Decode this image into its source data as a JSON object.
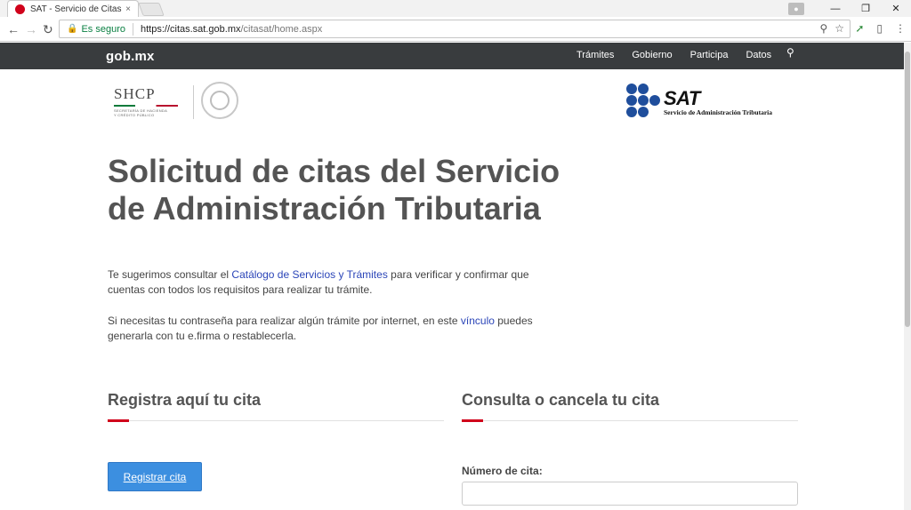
{
  "browser": {
    "tab_title": "SAT - Servicio de Citas",
    "tab_close": "×",
    "secure_label": "Es seguro",
    "url_host": "https://citas.sat.gob.mx",
    "url_path": "/citasat/home.aspx"
  },
  "govbar": {
    "logo": "gob.mx",
    "nav": [
      "Trámites",
      "Gobierno",
      "Participa",
      "Datos"
    ]
  },
  "logos": {
    "shcp_name": "SHCP",
    "shcp_sub1": "SECRETARÍA DE HACIENDA",
    "shcp_sub2": "Y CRÉDITO PÚBLICO",
    "sat_word": "SAT",
    "sat_full": "Servicio de Administración Tributaria"
  },
  "main": {
    "headline": "Solicitud de citas del Servicio de Administración Tributaria",
    "intro_pre": "Te sugerimos consultar el ",
    "intro_link": "Catálogo de Servicios y Trámites",
    "intro_post": " para verificar y confirmar que cuentas con todos los requisitos para realizar tu trámite.",
    "intro2_pre": "Si necesitas tu contraseña para realizar algún trámite por internet, en este ",
    "intro2_link": "vínculo",
    "intro2_post": " puedes generarla con tu e.firma o restablecerla.",
    "register_title": "Registra aquí tu cita",
    "register_button": "Registrar cita",
    "consult_title": "Consulta o cancela tu cita",
    "field_label": "Número de cita:",
    "field_value": ""
  }
}
